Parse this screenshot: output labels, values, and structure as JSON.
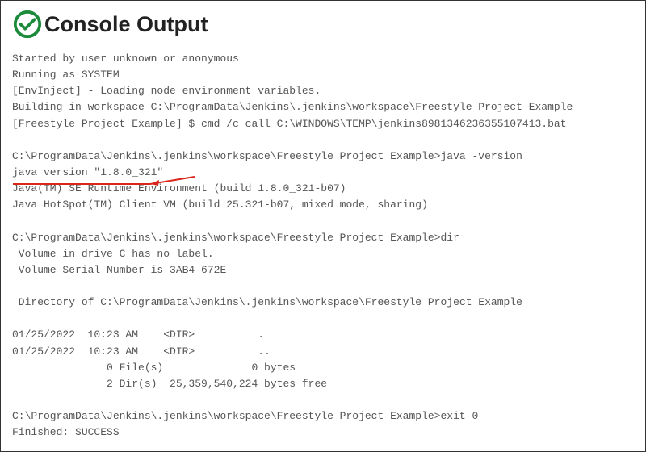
{
  "header": {
    "title": "Console Output",
    "icon": "success-check-icon",
    "icon_color": "#1b8a3a"
  },
  "console_lines": [
    "Started by user unknown or anonymous",
    "Running as SYSTEM",
    "[EnvInject] - Loading node environment variables.",
    "Building in workspace C:\\ProgramData\\Jenkins\\.jenkins\\workspace\\Freestyle Project Example",
    "[Freestyle Project Example] $ cmd /c call C:\\WINDOWS\\TEMP\\jenkins8981346236355107413.bat",
    "",
    "C:\\ProgramData\\Jenkins\\.jenkins\\workspace\\Freestyle Project Example>java -version",
    "java version \"1.8.0_321\"",
    "Java(TM) SE Runtime Environment (build 1.8.0_321-b07)",
    "Java HotSpot(TM) Client VM (build 25.321-b07, mixed mode, sharing)",
    "",
    "C:\\ProgramData\\Jenkins\\.jenkins\\workspace\\Freestyle Project Example>dir",
    " Volume in drive C has no label.",
    " Volume Serial Number is 3AB4-672E",
    "",
    " Directory of C:\\ProgramData\\Jenkins\\.jenkins\\workspace\\Freestyle Project Example",
    "",
    "01/25/2022  10:23 AM    <DIR>          .",
    "01/25/2022  10:23 AM    <DIR>          ..",
    "               0 File(s)              0 bytes",
    "               2 Dir(s)  25,359,540,224 bytes free",
    "",
    "C:\\ProgramData\\Jenkins\\.jenkins\\workspace\\Freestyle Project Example>exit 0",
    "Finished: SUCCESS"
  ],
  "annotation": {
    "color": "#d9261c"
  }
}
